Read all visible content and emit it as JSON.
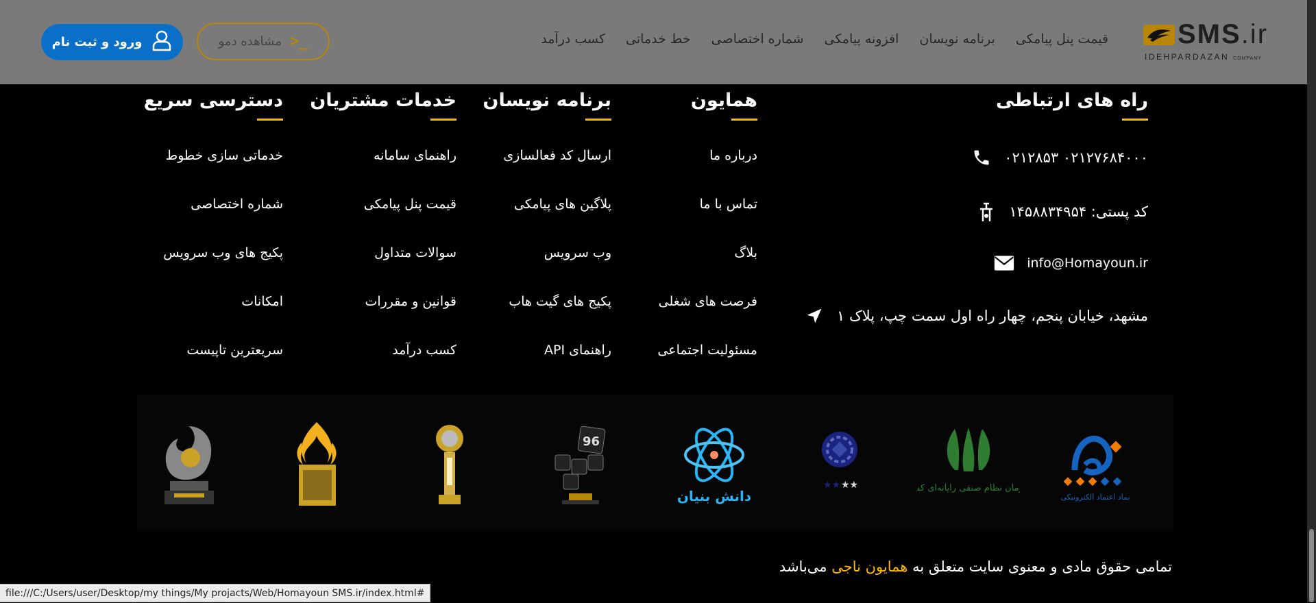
{
  "header": {
    "logo": {
      "brand": "SMS",
      "tld": ".ir",
      "company": "IDEHPARDAZAN",
      "company_suffix": "COMPANY"
    },
    "nav": [
      {
        "label": "قیمت پنل پیامکی"
      },
      {
        "label": "برنامه نویسان"
      },
      {
        "label": "افزونه پیامکی"
      },
      {
        "label": "شماره اختصاصی"
      },
      {
        "label": "خط خدماتی"
      },
      {
        "label": "کسب درآمد"
      }
    ],
    "demo_button": {
      "label": "مشاهده دمو",
      "icon": "terminal-icon"
    },
    "login_button": {
      "label": "ورود و ثبت نام",
      "icon": "user-icon"
    }
  },
  "footer": {
    "contact": {
      "title": "راه های ارتباطی",
      "phone": "۰۲۱۲۷۶۸۴۰۰۰    ۰۲۱۲۸۵۳",
      "postal": "کد پستی: ۱۴۵۸۸۳۴۹۵۴",
      "email": "info@Homayoun.ir",
      "address": "مشهد، خیابان پنجم، چهار راه اول سمت چپ، پلاک ۱"
    },
    "homayoun": {
      "title": "همایون",
      "links": [
        "درباره ما",
        "تماس با ما",
        "بلاگ",
        "فرصت های شغلی",
        "مسئولیت اجتماعی"
      ]
    },
    "developers": {
      "title": "برنامه نویسان",
      "links": [
        "ارسال کد فعالسازی",
        "پلاگین های پیامکی",
        "وب سرویس",
        "پکیج های گیت هاب",
        "راهنمای API"
      ]
    },
    "customer_services": {
      "title": "خدمات مشتریان",
      "links": [
        "راهنمای سامانه",
        "قیمت پنل پیامکی",
        "سوالات متداول",
        "قوانین و مقررات",
        "کسب درآمد"
      ]
    },
    "quick_access": {
      "title": "دسترسی سریع",
      "links": [
        "خدماتی سازی خطوط",
        "شماره اختصاصی",
        "پکیج های وب سرویس",
        "امکانات",
        "سریعترین تاپیست"
      ]
    },
    "badges": {
      "enamad": "نماد اعتماد الکترونیکی",
      "nezam": "سازمان نظام صنفی رایانه‌ای کشور",
      "daneshbonyan": "دانش بنیان",
      "idc": "96"
    },
    "copyright": {
      "prefix": "تمامی حقوق مادی و معنوی سایت متعلق به",
      "owner": "همایون ناجی",
      "suffix": "می‌باشد"
    }
  },
  "statusbar": {
    "url": "file:///C:/Users/user/Desktop/my things/My projacts/Web/Homayoun SMS.ir/index.html#"
  },
  "colors": {
    "accent": "#ffb900",
    "primary": "#0a6fc9",
    "header_bg": "#7a7a7a"
  }
}
